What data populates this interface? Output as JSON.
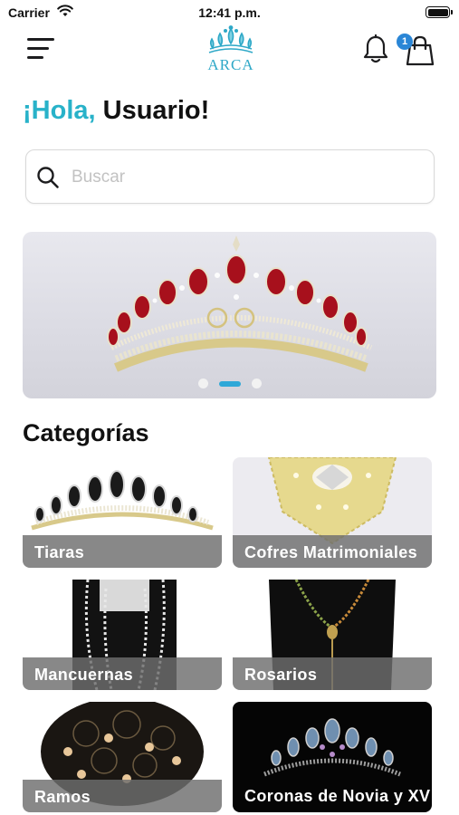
{
  "status_bar": {
    "carrier": "Carrier",
    "time": "12:41 p.m."
  },
  "header": {
    "logo_text": "ARCA",
    "cart_count": "1"
  },
  "greeting": {
    "hola": "¡Hola,",
    "name": "Usuario!"
  },
  "search": {
    "placeholder": "Buscar",
    "value": ""
  },
  "banner": {
    "slides": 3,
    "active_slide": 2
  },
  "categories": {
    "title": "Categorías",
    "items": [
      {
        "label": "Tiaras"
      },
      {
        "label": "Cofres Matrimoniales"
      },
      {
        "label": "Mancuernas"
      },
      {
        "label": "Rosarios"
      },
      {
        "label": "Ramos"
      },
      {
        "label": "Coronas de Novia y XV"
      }
    ]
  },
  "colors": {
    "accent": "#28b2c9",
    "badge": "#2a86d6",
    "dot_active": "#2ea8d8"
  }
}
